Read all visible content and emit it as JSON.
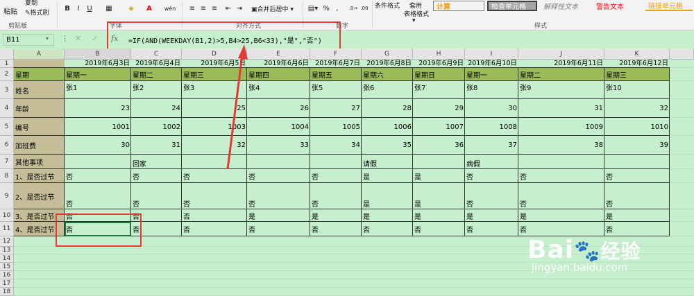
{
  "ribbon": {
    "clipboard": {
      "paste": "粘贴",
      "copy": "复制",
      "format_painter": "格式刷",
      "group": "剪贴板"
    },
    "font_group": "字体",
    "align_group": "对齐方式",
    "number_group": "数字",
    "styles_group": "样式",
    "merge_center": "合并后居中",
    "cond_format": "条件格式",
    "table_format_1": "套用",
    "table_format_2": "表格格式",
    "percent": "%",
    "comma": ",",
    "styles": [
      {
        "label": "计算",
        "color": "#f39c12",
        "bg": "#f2f2f2"
      },
      {
        "label": "检查单元格",
        "color": "#ffffff",
        "bg": "#a5a5a5"
      },
      {
        "label": "解释性文本",
        "color": "#7f7f7f",
        "bg": "#f3f3f3"
      },
      {
        "label": "警告文本",
        "color": "#ff0000",
        "bg": "#f3f3f3"
      },
      {
        "label": "链接单元格",
        "color": "#f39c12",
        "bg": "#f3f3f3"
      }
    ]
  },
  "formula_bar": {
    "name_box": "B11",
    "fx": "fx",
    "formula": "=IF(AND(WEEKDAY(B1,2)>5,B4>25,B6<33),\"是\",\"否\")"
  },
  "columns": [
    "A",
    "B",
    "C",
    "D",
    "E",
    "F",
    "G",
    "H",
    "I",
    "J",
    "K"
  ],
  "rows": [
    "1",
    "2",
    "3",
    "4",
    "5",
    "6",
    "7",
    "8",
    "9",
    "10",
    "11",
    "12",
    "13",
    "14",
    "15",
    "16",
    "17",
    "18"
  ],
  "sheet": {
    "dates": [
      "2019年6月3日",
      "2019年6月4日",
      "2019年6月5日",
      "2019年6月6日",
      "2019年6月7日",
      "2019年6月8日",
      "2019年6月9日",
      "2019年6月10日",
      "2019年6月11日",
      "2019年6月12日"
    ],
    "row_labels": [
      "星期",
      "姓名",
      "年龄",
      "编号",
      "加班费",
      "其他事项",
      "1、是否过节",
      "2、是否过节",
      "3、是否过节",
      "4、是否过节"
    ],
    "weekdays": [
      "星期一",
      "星期二",
      "星期三",
      "星期四",
      "星期五",
      "星期六",
      "星期日",
      "星期一",
      "星期二",
      "星期三"
    ],
    "names": [
      "张1",
      "张2",
      "张3",
      "张4",
      "张5",
      "张6",
      "张7",
      "张8",
      "张9",
      "张10"
    ],
    "ages": [
      "23",
      "24",
      "25",
      "26",
      "27",
      "28",
      "29",
      "30",
      "31",
      "32"
    ],
    "ids": [
      "1001",
      "1002",
      "1003",
      "1004",
      "1005",
      "1006",
      "1007",
      "1008",
      "1009",
      "1010"
    ],
    "overtime": [
      "30",
      "31",
      "32",
      "33",
      "34",
      "35",
      "36",
      "37",
      "38",
      "39"
    ],
    "other": [
      "",
      "回家",
      "",
      "",
      "",
      "请假",
      "",
      "病假",
      "",
      ""
    ],
    "q1": [
      "否",
      "否",
      "否",
      "否",
      "否",
      "是",
      "是",
      "否",
      "否",
      "否"
    ],
    "q2": [
      "否",
      "否",
      "否",
      "否",
      "否",
      "是",
      "是",
      "否",
      "否",
      "否"
    ],
    "q3": [
      "否",
      "否",
      "否",
      "是",
      "是",
      "是",
      "是",
      "是",
      "是",
      "是"
    ],
    "q4": [
      "否",
      "否",
      "否",
      "否",
      "否",
      "否",
      "否",
      "否",
      "否",
      "否"
    ]
  },
  "watermark": {
    "brand": "Bai",
    "brand2": "经验",
    "url": "jingyan.baidu.com"
  },
  "colors": {
    "sheet_bg": "#c6efce",
    "header_row": "#9bbb59",
    "label_col": "#c4bd97",
    "annotation": "#e53935"
  }
}
